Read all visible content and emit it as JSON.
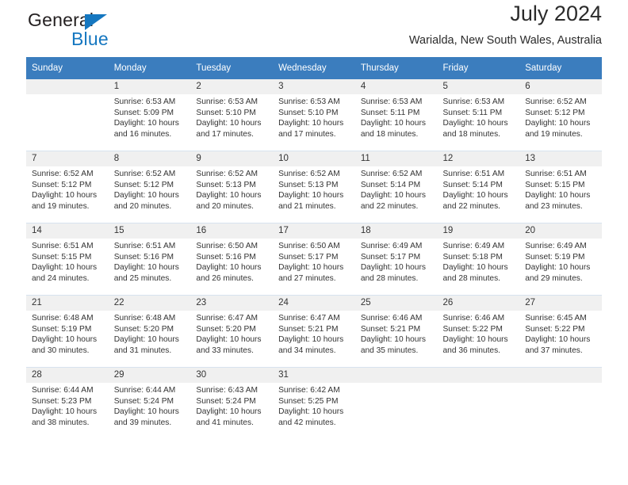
{
  "brand": {
    "word1": "General",
    "word2": "Blue",
    "triangle_color": "#1577c0"
  },
  "header": {
    "title": "July 2024",
    "subtitle": "Warialda, New South Wales, Australia"
  },
  "colors": {
    "header_blue": "#3b7dbe",
    "daynum_band": "#f0f0f0",
    "row_divider": "#d7e3ef",
    "text": "#333333"
  },
  "weekday_headers": [
    "Sunday",
    "Monday",
    "Tuesday",
    "Wednesday",
    "Thursday",
    "Friday",
    "Saturday"
  ],
  "weeks": [
    [
      {
        "day": "",
        "sunrise": "",
        "sunset": "",
        "daylight_line1": "",
        "daylight_line2": ""
      },
      {
        "day": "1",
        "sunrise": "Sunrise: 6:53 AM",
        "sunset": "Sunset: 5:09 PM",
        "daylight_line1": "Daylight: 10 hours",
        "daylight_line2": "and 16 minutes."
      },
      {
        "day": "2",
        "sunrise": "Sunrise: 6:53 AM",
        "sunset": "Sunset: 5:10 PM",
        "daylight_line1": "Daylight: 10 hours",
        "daylight_line2": "and 17 minutes."
      },
      {
        "day": "3",
        "sunrise": "Sunrise: 6:53 AM",
        "sunset": "Sunset: 5:10 PM",
        "daylight_line1": "Daylight: 10 hours",
        "daylight_line2": "and 17 minutes."
      },
      {
        "day": "4",
        "sunrise": "Sunrise: 6:53 AM",
        "sunset": "Sunset: 5:11 PM",
        "daylight_line1": "Daylight: 10 hours",
        "daylight_line2": "and 18 minutes."
      },
      {
        "day": "5",
        "sunrise": "Sunrise: 6:53 AM",
        "sunset": "Sunset: 5:11 PM",
        "daylight_line1": "Daylight: 10 hours",
        "daylight_line2": "and 18 minutes."
      },
      {
        "day": "6",
        "sunrise": "Sunrise: 6:52 AM",
        "sunset": "Sunset: 5:12 PM",
        "daylight_line1": "Daylight: 10 hours",
        "daylight_line2": "and 19 minutes."
      }
    ],
    [
      {
        "day": "7",
        "sunrise": "Sunrise: 6:52 AM",
        "sunset": "Sunset: 5:12 PM",
        "daylight_line1": "Daylight: 10 hours",
        "daylight_line2": "and 19 minutes."
      },
      {
        "day": "8",
        "sunrise": "Sunrise: 6:52 AM",
        "sunset": "Sunset: 5:12 PM",
        "daylight_line1": "Daylight: 10 hours",
        "daylight_line2": "and 20 minutes."
      },
      {
        "day": "9",
        "sunrise": "Sunrise: 6:52 AM",
        "sunset": "Sunset: 5:13 PM",
        "daylight_line1": "Daylight: 10 hours",
        "daylight_line2": "and 20 minutes."
      },
      {
        "day": "10",
        "sunrise": "Sunrise: 6:52 AM",
        "sunset": "Sunset: 5:13 PM",
        "daylight_line1": "Daylight: 10 hours",
        "daylight_line2": "and 21 minutes."
      },
      {
        "day": "11",
        "sunrise": "Sunrise: 6:52 AM",
        "sunset": "Sunset: 5:14 PM",
        "daylight_line1": "Daylight: 10 hours",
        "daylight_line2": "and 22 minutes."
      },
      {
        "day": "12",
        "sunrise": "Sunrise: 6:51 AM",
        "sunset": "Sunset: 5:14 PM",
        "daylight_line1": "Daylight: 10 hours",
        "daylight_line2": "and 22 minutes."
      },
      {
        "day": "13",
        "sunrise": "Sunrise: 6:51 AM",
        "sunset": "Sunset: 5:15 PM",
        "daylight_line1": "Daylight: 10 hours",
        "daylight_line2": "and 23 minutes."
      }
    ],
    [
      {
        "day": "14",
        "sunrise": "Sunrise: 6:51 AM",
        "sunset": "Sunset: 5:15 PM",
        "daylight_line1": "Daylight: 10 hours",
        "daylight_line2": "and 24 minutes."
      },
      {
        "day": "15",
        "sunrise": "Sunrise: 6:51 AM",
        "sunset": "Sunset: 5:16 PM",
        "daylight_line1": "Daylight: 10 hours",
        "daylight_line2": "and 25 minutes."
      },
      {
        "day": "16",
        "sunrise": "Sunrise: 6:50 AM",
        "sunset": "Sunset: 5:16 PM",
        "daylight_line1": "Daylight: 10 hours",
        "daylight_line2": "and 26 minutes."
      },
      {
        "day": "17",
        "sunrise": "Sunrise: 6:50 AM",
        "sunset": "Sunset: 5:17 PM",
        "daylight_line1": "Daylight: 10 hours",
        "daylight_line2": "and 27 minutes."
      },
      {
        "day": "18",
        "sunrise": "Sunrise: 6:49 AM",
        "sunset": "Sunset: 5:17 PM",
        "daylight_line1": "Daylight: 10 hours",
        "daylight_line2": "and 28 minutes."
      },
      {
        "day": "19",
        "sunrise": "Sunrise: 6:49 AM",
        "sunset": "Sunset: 5:18 PM",
        "daylight_line1": "Daylight: 10 hours",
        "daylight_line2": "and 28 minutes."
      },
      {
        "day": "20",
        "sunrise": "Sunrise: 6:49 AM",
        "sunset": "Sunset: 5:19 PM",
        "daylight_line1": "Daylight: 10 hours",
        "daylight_line2": "and 29 minutes."
      }
    ],
    [
      {
        "day": "21",
        "sunrise": "Sunrise: 6:48 AM",
        "sunset": "Sunset: 5:19 PM",
        "daylight_line1": "Daylight: 10 hours",
        "daylight_line2": "and 30 minutes."
      },
      {
        "day": "22",
        "sunrise": "Sunrise: 6:48 AM",
        "sunset": "Sunset: 5:20 PM",
        "daylight_line1": "Daylight: 10 hours",
        "daylight_line2": "and 31 minutes."
      },
      {
        "day": "23",
        "sunrise": "Sunrise: 6:47 AM",
        "sunset": "Sunset: 5:20 PM",
        "daylight_line1": "Daylight: 10 hours",
        "daylight_line2": "and 33 minutes."
      },
      {
        "day": "24",
        "sunrise": "Sunrise: 6:47 AM",
        "sunset": "Sunset: 5:21 PM",
        "daylight_line1": "Daylight: 10 hours",
        "daylight_line2": "and 34 minutes."
      },
      {
        "day": "25",
        "sunrise": "Sunrise: 6:46 AM",
        "sunset": "Sunset: 5:21 PM",
        "daylight_line1": "Daylight: 10 hours",
        "daylight_line2": "and 35 minutes."
      },
      {
        "day": "26",
        "sunrise": "Sunrise: 6:46 AM",
        "sunset": "Sunset: 5:22 PM",
        "daylight_line1": "Daylight: 10 hours",
        "daylight_line2": "and 36 minutes."
      },
      {
        "day": "27",
        "sunrise": "Sunrise: 6:45 AM",
        "sunset": "Sunset: 5:22 PM",
        "daylight_line1": "Daylight: 10 hours",
        "daylight_line2": "and 37 minutes."
      }
    ],
    [
      {
        "day": "28",
        "sunrise": "Sunrise: 6:44 AM",
        "sunset": "Sunset: 5:23 PM",
        "daylight_line1": "Daylight: 10 hours",
        "daylight_line2": "and 38 minutes."
      },
      {
        "day": "29",
        "sunrise": "Sunrise: 6:44 AM",
        "sunset": "Sunset: 5:24 PM",
        "daylight_line1": "Daylight: 10 hours",
        "daylight_line2": "and 39 minutes."
      },
      {
        "day": "30",
        "sunrise": "Sunrise: 6:43 AM",
        "sunset": "Sunset: 5:24 PM",
        "daylight_line1": "Daylight: 10 hours",
        "daylight_line2": "and 41 minutes."
      },
      {
        "day": "31",
        "sunrise": "Sunrise: 6:42 AM",
        "sunset": "Sunset: 5:25 PM",
        "daylight_line1": "Daylight: 10 hours",
        "daylight_line2": "and 42 minutes."
      },
      {
        "day": "",
        "sunrise": "",
        "sunset": "",
        "daylight_line1": "",
        "daylight_line2": ""
      },
      {
        "day": "",
        "sunrise": "",
        "sunset": "",
        "daylight_line1": "",
        "daylight_line2": ""
      },
      {
        "day": "",
        "sunrise": "",
        "sunset": "",
        "daylight_line1": "",
        "daylight_line2": ""
      }
    ]
  ]
}
